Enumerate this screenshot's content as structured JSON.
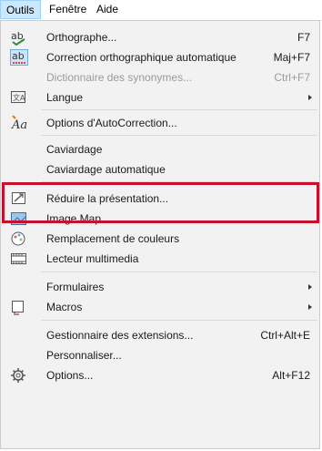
{
  "menubar": {
    "items": [
      {
        "label": "Outils"
      },
      {
        "label": "Fenêtre"
      },
      {
        "label": "Aide"
      }
    ]
  },
  "menu": {
    "items": [
      {
        "label": "Orthographe...",
        "shortcut": "F7"
      },
      {
        "label": "Correction orthographique automatique",
        "shortcut": "Maj+F7"
      },
      {
        "label": "Dictionnaire des synonymes...",
        "shortcut": "Ctrl+F7"
      },
      {
        "label": "Langue"
      },
      {
        "label": "Options d'AutoCorrection..."
      },
      {
        "label": "Caviardage"
      },
      {
        "label": "Caviardage automatique"
      },
      {
        "label": "Réduire la présentation..."
      },
      {
        "label": "Image Map"
      },
      {
        "label": "Remplacement de couleurs"
      },
      {
        "label": "Lecteur multimedia"
      },
      {
        "label": "Formulaires"
      },
      {
        "label": "Macros"
      },
      {
        "label": "Gestionnaire des extensions...",
        "shortcut": "Ctrl+Alt+E"
      },
      {
        "label": "Personnaliser..."
      },
      {
        "label": "Options...",
        "shortcut": "Alt+F12"
      }
    ]
  },
  "icons": {
    "spell": "spelling-icon",
    "autospell": "auto-spellcheck-icon",
    "language": "language-icon",
    "autocorrect": "autocorrect-icon",
    "compress": "compress-presentation-icon",
    "imagemap": "image-map-icon",
    "colorreplace": "color-replacer-icon",
    "media": "media-player-icon",
    "macros": "macros-icon",
    "options": "options-gear-icon"
  },
  "colors": {
    "highlight_border": "#c8102e",
    "menu_bg": "#f2f2f2",
    "active_menubar": "#cce8ff"
  }
}
